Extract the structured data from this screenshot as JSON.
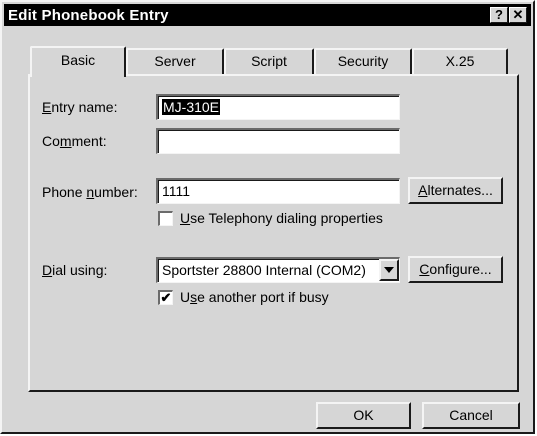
{
  "window": {
    "title": "Edit Phonebook Entry",
    "help_glyph": "?",
    "close_glyph": "✕"
  },
  "tabs": [
    {
      "label": "Basic",
      "active": true
    },
    {
      "label": "Server",
      "active": false
    },
    {
      "label": "Script",
      "active": false
    },
    {
      "label": "Security",
      "active": false
    },
    {
      "label": "X.25",
      "active": false
    }
  ],
  "form": {
    "entry_name": {
      "label_mnemonic": "E",
      "label_rest": "ntry name:",
      "value": "MJ-310E"
    },
    "comment": {
      "label_pre": "Co",
      "label_mnemonic": "m",
      "label_rest": "ment:",
      "value": ""
    },
    "phone_number": {
      "label_pre": "Phone ",
      "label_mnemonic": "n",
      "label_rest": "umber:",
      "value": "1111"
    },
    "alternates_button": {
      "label_mnemonic": "A",
      "label_rest": "lternates..."
    },
    "telephony_checkbox": {
      "label_mnemonic": "U",
      "label_rest": "se Telephony dialing properties",
      "checked": false
    },
    "dial_using": {
      "label_mnemonic": "D",
      "label_rest": "ial using:",
      "value": "Sportster 28800 Internal (COM2)"
    },
    "configure_button": {
      "label_mnemonic": "C",
      "label_rest": "onfigure..."
    },
    "another_port_checkbox": {
      "label_pre": "U",
      "label_mnemonic": "s",
      "label_rest": "e another port if busy",
      "checked": true,
      "check_glyph": "✔"
    }
  },
  "footer": {
    "ok_label": "OK",
    "cancel_label": "Cancel"
  },
  "icons": {
    "dropdown": "chevron-down-icon",
    "check": "checkmark-icon"
  }
}
